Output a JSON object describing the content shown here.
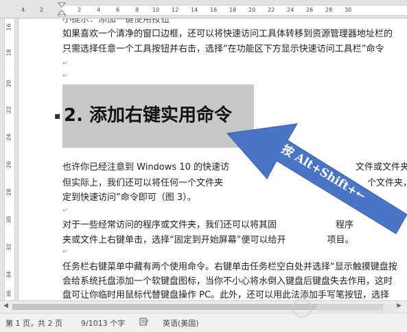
{
  "ruler": {
    "ticks": [
      "4",
      "2",
      "2",
      "4",
      "6",
      "8",
      "10",
      "12",
      "14",
      "16",
      "18",
      "20",
      "22",
      "24",
      "26",
      "28",
      "30"
    ],
    "vticks": [
      "16",
      "18",
      "20",
      "22",
      "24",
      "26",
      "28",
      "30",
      "32",
      "34",
      "36"
    ]
  },
  "doc": {
    "line0": "小提示：添加一键使用按钮",
    "line1": "如果喜欢一个清净的窗口边框，还可以将快速访问工具体转移到资源管理器地址栏的",
    "line2": "只需选择任意一个工具按钮并右击，选择“在功能区下方显示快速访问工具栏”命令",
    "heading": "2. 添加右键实用命令",
    "para2_line1": "也许你已经注意到 Windows 10 的快速访",
    "para2_line1b": "文件或文件夹的痕迹",
    "para2_line2": "但实际上，我们还可以将任何一个文件夹",
    "para2_line2b": "个文件夹，选",
    "para2_line3": "定到快速访问”命令即可（图 3）。",
    "para3_line1": "对于一些经常访问的程序或文件夹，我们还可以将其固",
    "para3_line1b": "程序",
    "para3_line2": "夹或文件上右键单击，选择“固定到开始屏幕”便可以给开",
    "para3_line2b": "项目。",
    "para4_line1": "任务栏右键菜单中藏有两个使用命令。右键单击任务栏空白处并选择“显示触摸键盘按",
    "para4_line2": "会给系统托盘添加一个软键盘图标，当你不小心将水倒入键盘后键盘失去作用，这时",
    "para4_line3": "盘可让你临时用鼠标代替键盘操作 PC。此外，还可以用此法添加手写笔按钮，选择"
  },
  "callout": {
    "text": "按 Alt+Shift+←",
    "color": "#4a74c4"
  },
  "status": {
    "page": "第 1 页，共 2 页",
    "words": "9/1013 个字",
    "proof_icon": "proofing-icon",
    "language": "英语(美国)"
  }
}
